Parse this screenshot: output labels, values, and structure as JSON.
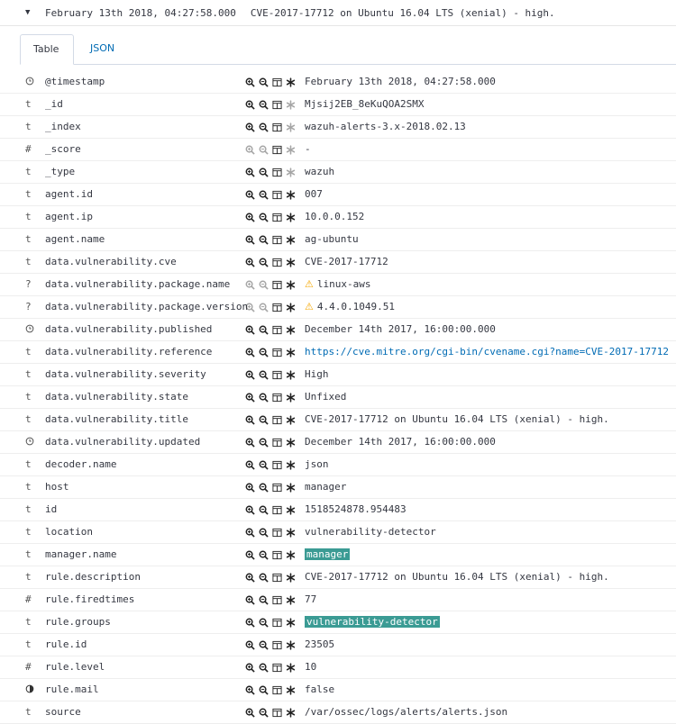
{
  "header": {
    "timestamp": "February 13th 2018, 04:27:58.000",
    "summary": "CVE-2017-17712 on Ubuntu 16.04 LTS (xenial) - high."
  },
  "tabs": [
    {
      "label": "Table",
      "active": true
    },
    {
      "label": "JSON",
      "active": false
    }
  ],
  "rows": [
    {
      "type": "clock",
      "field": "@timestamp",
      "value": "February 13th 2018, 04:27:58.000"
    },
    {
      "type": "t",
      "field": "_id",
      "value": "Mjsij2EB_8eKuQOA2SMX",
      "dim_star": true
    },
    {
      "type": "t",
      "field": "_index",
      "value": "wazuh-alerts-3.x-2018.02.13",
      "dim_star": true
    },
    {
      "type": "#",
      "field": "_score",
      "value": "-",
      "dim_all": true
    },
    {
      "type": "t",
      "field": "_type",
      "value": "wazuh",
      "dim_star": true
    },
    {
      "type": "t",
      "field": "agent.id",
      "value": "007"
    },
    {
      "type": "t",
      "field": "agent.ip",
      "value": "10.0.0.152"
    },
    {
      "type": "t",
      "field": "agent.name",
      "value": "ag-ubuntu"
    },
    {
      "type": "t",
      "field": "data.vulnerability.cve",
      "value": "CVE-2017-17712"
    },
    {
      "type": "?",
      "field": "data.vulnerability.package.name",
      "value": "linux-aws",
      "warn": true,
      "dim_zoom": true
    },
    {
      "type": "?",
      "field": "data.vulnerability.package.version",
      "value": "4.4.0.1049.51",
      "warn": true,
      "dim_zoom": true
    },
    {
      "type": "clock",
      "field": "data.vulnerability.published",
      "value": "December 14th 2017, 16:00:00.000"
    },
    {
      "type": "t",
      "field": "data.vulnerability.reference",
      "value": "https://cve.mitre.org/cgi-bin/cvename.cgi?name=CVE-2017-17712",
      "link": true
    },
    {
      "type": "t",
      "field": "data.vulnerability.severity",
      "value": "High"
    },
    {
      "type": "t",
      "field": "data.vulnerability.state",
      "value": "Unfixed"
    },
    {
      "type": "t",
      "field": "data.vulnerability.title",
      "value": "CVE-2017-17712 on Ubuntu 16.04 LTS (xenial) - high."
    },
    {
      "type": "clock",
      "field": "data.vulnerability.updated",
      "value": "December 14th 2017, 16:00:00.000"
    },
    {
      "type": "t",
      "field": "decoder.name",
      "value": "json"
    },
    {
      "type": "t",
      "field": "host",
      "value": "manager"
    },
    {
      "type": "t",
      "field": "id",
      "value": "1518524878.954483"
    },
    {
      "type": "t",
      "field": "location",
      "value": "vulnerability-detector"
    },
    {
      "type": "t",
      "field": "manager.name",
      "value": "manager",
      "highlight": true
    },
    {
      "type": "t",
      "field": "rule.description",
      "value": "CVE-2017-17712 on Ubuntu 16.04 LTS (xenial) - high."
    },
    {
      "type": "#",
      "field": "rule.firedtimes",
      "value": "77"
    },
    {
      "type": "t",
      "field": "rule.groups",
      "value": "vulnerability-detector",
      "highlight": true
    },
    {
      "type": "t",
      "field": "rule.id",
      "value": "23505"
    },
    {
      "type": "#",
      "field": "rule.level",
      "value": "10"
    },
    {
      "type": "bool",
      "field": "rule.mail",
      "value": "false"
    },
    {
      "type": "t",
      "field": "source",
      "value": "/var/ossec/logs/alerts/alerts.json"
    }
  ],
  "colors": {
    "link": "#006bb4",
    "highlight": "#3b9b94",
    "warning": "#f5a700"
  }
}
